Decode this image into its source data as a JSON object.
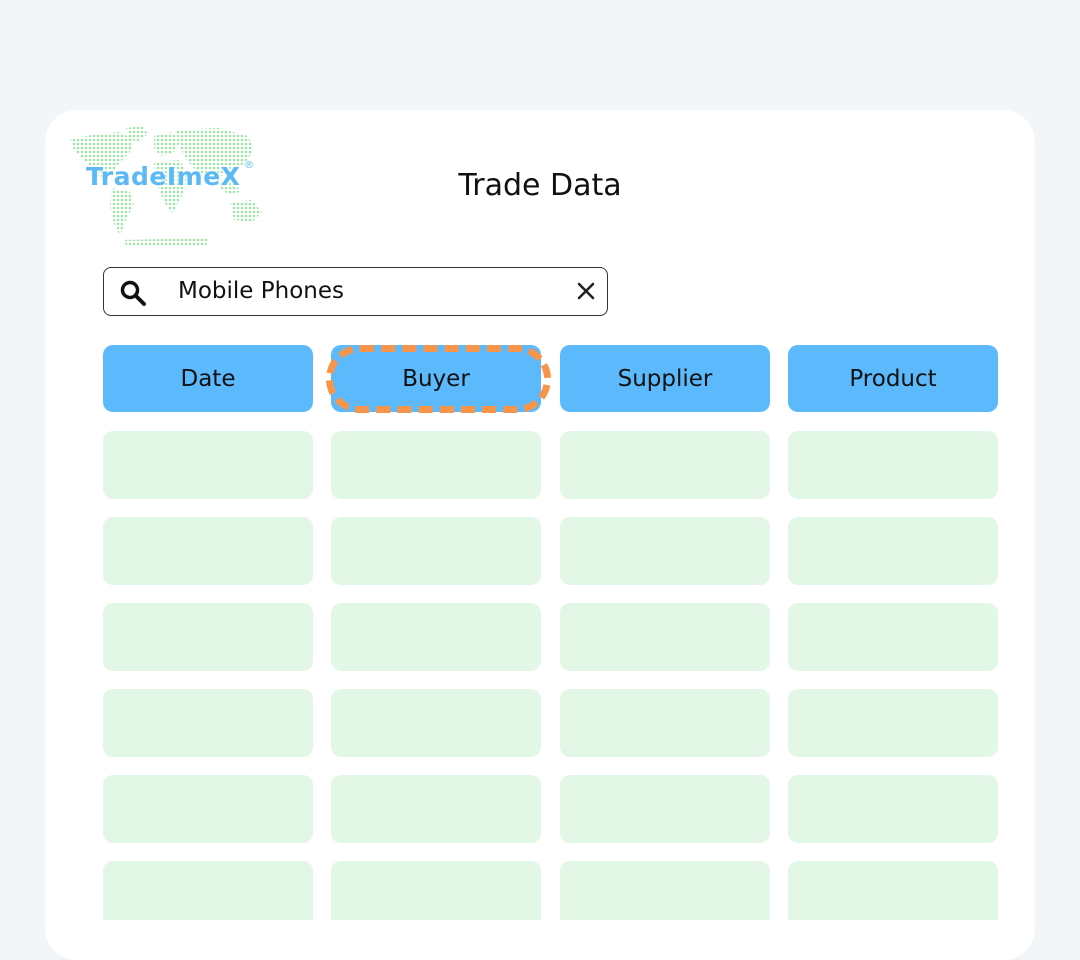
{
  "brand": {
    "name": "TradeImeX",
    "trademark": "®"
  },
  "page": {
    "title": "Trade Data"
  },
  "search": {
    "value": "Mobile Phones",
    "icon": "search-icon",
    "clear_icon": "close-icon"
  },
  "table": {
    "columns": [
      {
        "label": "Date"
      },
      {
        "label": "Buyer"
      },
      {
        "label": "Supplier"
      },
      {
        "label": "Product"
      }
    ],
    "highlighted_column": "Buyer",
    "placeholder_rows_visible": 6
  },
  "colors": {
    "background": "#f2f6f9",
    "card": "#ffffff",
    "header_fill": "#5cb9fc",
    "row_fill": "#e3f7e6",
    "highlight_dash": "#f7964a",
    "logo_text": "#5cb9f5",
    "logo_map": "#9fe4a8"
  }
}
